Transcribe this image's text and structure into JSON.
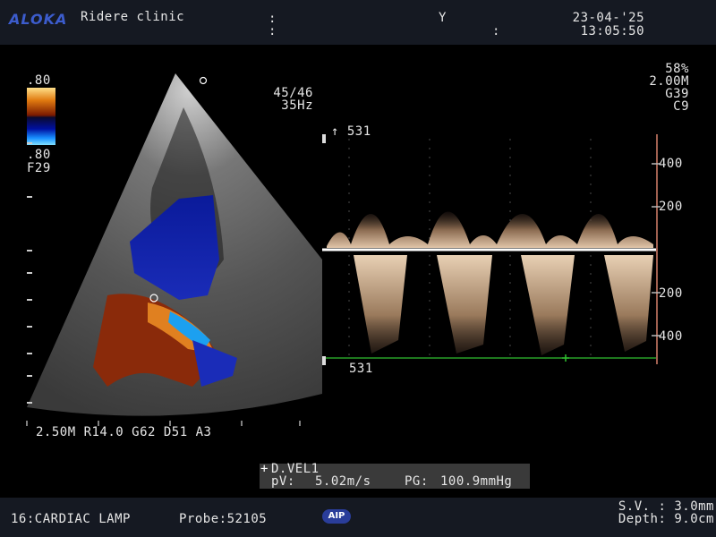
{
  "header": {
    "brand": "ALOKA",
    "clinic": "Ridere clinic",
    "colon_top": ":",
    "colon_bottom": ":",
    "y_label": "Y",
    "mid_colon": ":",
    "date": "23-04-'25",
    "time": "13:05:50"
  },
  "doppler_settings": {
    "scale_top": ".80",
    "scale_bottom": ".80",
    "filter": "F29",
    "frame": "45/46",
    "frame_rate": "35Hz",
    "power": "58%",
    "freq": "2.00M",
    "gain": "G39",
    "c_setting": "C9"
  },
  "image_params": "2.50M R14.0 G62 D51 A3",
  "spectral": {
    "top_velocity": "↑ 531",
    "bottom_velocity": "531",
    "scale_labels": [
      "400",
      "200",
      "200",
      "400"
    ]
  },
  "measurement": {
    "title": "D.VEL1",
    "pv_label": "pV:",
    "pv_value": "5.02m/s",
    "pg_label": "PG:",
    "pg_value": "100.9mmHg"
  },
  "footer": {
    "preset": "16:CARDIAC LAMP",
    "probe": "Probe:52105",
    "aip": "AIP",
    "sv": "S.V. : 3.0mm",
    "depth": "Depth: 9.0cm"
  },
  "colors": {
    "header_bg": "#151922",
    "brand": "#3c5ccc",
    "baseline": "#ffffff",
    "cursor_line": "#30c030",
    "scale_bar": "#a06050"
  }
}
